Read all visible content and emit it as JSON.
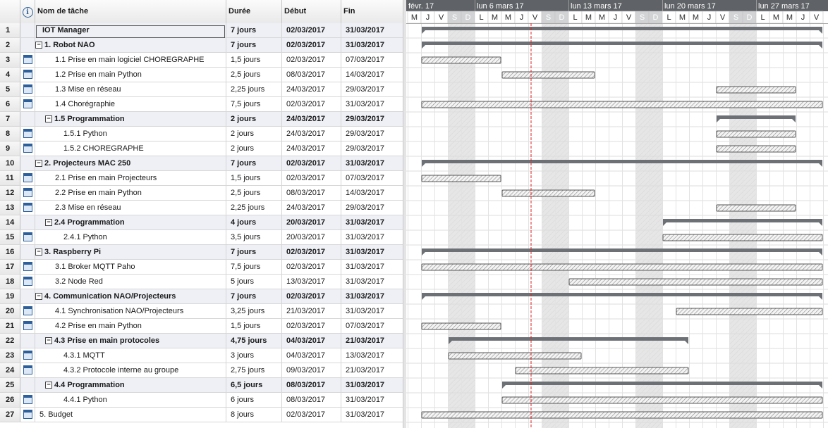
{
  "columns": {
    "id": "",
    "info_icon": "info-icon",
    "name": "Nom de tâche",
    "duration": "Durée",
    "start": "Début",
    "end": "Fin"
  },
  "tasks": [
    {
      "id": "1",
      "name": "IOT Manager",
      "duration": "7 jours",
      "start": "02/03/2017",
      "end": "31/03/2017",
      "level": 0,
      "summary": true,
      "icon": false,
      "toggle": false
    },
    {
      "id": "2",
      "name": "1. Robot NAO",
      "duration": "7 jours",
      "start": "02/03/2017",
      "end": "31/03/2017",
      "level": 0,
      "summary": true,
      "icon": false,
      "toggle": true
    },
    {
      "id": "3",
      "name": "1.1 Prise en main logiciel CHOREGRAPHE",
      "duration": "1,5 jours",
      "start": "02/03/2017",
      "end": "07/03/2017",
      "level": 1,
      "summary": false,
      "icon": true,
      "toggle": false
    },
    {
      "id": "4",
      "name": "1.2 Prise en main Python",
      "duration": "2,5 jours",
      "start": "08/03/2017",
      "end": "14/03/2017",
      "level": 1,
      "summary": false,
      "icon": true,
      "toggle": false
    },
    {
      "id": "5",
      "name": "1.3 Mise en réseau",
      "duration": "2,25 jours",
      "start": "24/03/2017",
      "end": "29/03/2017",
      "level": 1,
      "summary": false,
      "icon": true,
      "toggle": false
    },
    {
      "id": "6",
      "name": "1.4 Chorégraphie",
      "duration": "7,5 jours",
      "start": "02/03/2017",
      "end": "31/03/2017",
      "level": 1,
      "summary": false,
      "icon": true,
      "toggle": false
    },
    {
      "id": "7",
      "name": "1.5 Programmation",
      "duration": "2 jours",
      "start": "24/03/2017",
      "end": "29/03/2017",
      "level": 1,
      "summary": true,
      "icon": false,
      "toggle": true
    },
    {
      "id": "8",
      "name": "1.5.1 Python",
      "duration": "2 jours",
      "start": "24/03/2017",
      "end": "29/03/2017",
      "level": 2,
      "summary": false,
      "icon": true,
      "toggle": false
    },
    {
      "id": "9",
      "name": "1.5.2 CHOREGRAPHE",
      "duration": "2 jours",
      "start": "24/03/2017",
      "end": "29/03/2017",
      "level": 2,
      "summary": false,
      "icon": true,
      "toggle": false
    },
    {
      "id": "10",
      "name": "2. Projecteurs MAC 250",
      "duration": "7 jours",
      "start": "02/03/2017",
      "end": "31/03/2017",
      "level": 0,
      "summary": true,
      "icon": false,
      "toggle": true
    },
    {
      "id": "11",
      "name": "2.1 Prise en main Projecteurs",
      "duration": "1,5 jours",
      "start": "02/03/2017",
      "end": "07/03/2017",
      "level": 1,
      "summary": false,
      "icon": true,
      "toggle": false
    },
    {
      "id": "12",
      "name": "2.2 Prise en main Python",
      "duration": "2,5 jours",
      "start": "08/03/2017",
      "end": "14/03/2017",
      "level": 1,
      "summary": false,
      "icon": true,
      "toggle": false
    },
    {
      "id": "13",
      "name": "2.3 Mise en réseau",
      "duration": "2,25 jours",
      "start": "24/03/2017",
      "end": "29/03/2017",
      "level": 1,
      "summary": false,
      "icon": true,
      "toggle": false
    },
    {
      "id": "14",
      "name": "2.4 Programmation",
      "duration": "4 jours",
      "start": "20/03/2017",
      "end": "31/03/2017",
      "level": 1,
      "summary": true,
      "icon": false,
      "toggle": true
    },
    {
      "id": "15",
      "name": "2.4.1 Python",
      "duration": "3,5 jours",
      "start": "20/03/2017",
      "end": "31/03/2017",
      "level": 2,
      "summary": false,
      "icon": true,
      "toggle": false
    },
    {
      "id": "16",
      "name": "3. Raspberry Pi",
      "duration": "7 jours",
      "start": "02/03/2017",
      "end": "31/03/2017",
      "level": 0,
      "summary": true,
      "icon": false,
      "toggle": true
    },
    {
      "id": "17",
      "name": "3.1 Broker MQTT Paho",
      "duration": "7,5 jours",
      "start": "02/03/2017",
      "end": "31/03/2017",
      "level": 1,
      "summary": false,
      "icon": true,
      "toggle": false
    },
    {
      "id": "18",
      "name": "3.2 Node Red",
      "duration": "5 jours",
      "start": "13/03/2017",
      "end": "31/03/2017",
      "level": 1,
      "summary": false,
      "icon": true,
      "toggle": false
    },
    {
      "id": "19",
      "name": "4. Communication NAO/Projecteurs",
      "duration": "7 jours",
      "start": "02/03/2017",
      "end": "31/03/2017",
      "level": 0,
      "summary": true,
      "icon": false,
      "toggle": true
    },
    {
      "id": "20",
      "name": "4.1 Synchronisation NAO/Projecteurs",
      "duration": "3,25 jours",
      "start": "21/03/2017",
      "end": "31/03/2017",
      "level": 1,
      "summary": false,
      "icon": true,
      "toggle": false
    },
    {
      "id": "21",
      "name": "4.2 Prise en main Python",
      "duration": "1,5 jours",
      "start": "02/03/2017",
      "end": "07/03/2017",
      "level": 1,
      "summary": false,
      "icon": true,
      "toggle": false
    },
    {
      "id": "22",
      "name": "4.3 Prise en main protocoles",
      "duration": "4,75 jours",
      "start": "04/03/2017",
      "end": "21/03/2017",
      "level": 1,
      "summary": true,
      "icon": false,
      "toggle": true
    },
    {
      "id": "23",
      "name": "4.3.1 MQTT",
      "duration": "3 jours",
      "start": "04/03/2017",
      "end": "13/03/2017",
      "level": 2,
      "summary": false,
      "icon": true,
      "toggle": false
    },
    {
      "id": "24",
      "name": "4.3.2 Protocole interne au groupe",
      "duration": "2,75 jours",
      "start": "09/03/2017",
      "end": "21/03/2017",
      "level": 2,
      "summary": false,
      "icon": true,
      "toggle": false
    },
    {
      "id": "25",
      "name": "4.4 Programmation",
      "duration": "6,5 jours",
      "start": "08/03/2017",
      "end": "31/03/2017",
      "level": 1,
      "summary": true,
      "icon": false,
      "toggle": true
    },
    {
      "id": "26",
      "name": "4.4.1 Python",
      "duration": "6 jours",
      "start": "08/03/2017",
      "end": "31/03/2017",
      "level": 2,
      "summary": false,
      "icon": true,
      "toggle": false
    },
    {
      "id": "27",
      "name": "5. Budget",
      "duration": "8 jours",
      "start": "02/03/2017",
      "end": "31/03/2017",
      "level": 0,
      "summary": false,
      "icon": true,
      "toggle": false
    }
  ],
  "timeline": {
    "weeks": [
      "févr. 17",
      "lun 6 mars 17",
      "lun 13 mars 17",
      "lun 20 mars 17",
      "lun 27 mars 17"
    ],
    "days": [
      "M",
      "J",
      "V",
      "S",
      "D",
      "L",
      "M",
      "M",
      "J",
      "V",
      "S",
      "D",
      "L",
      "M",
      "M",
      "J",
      "V",
      "S",
      "D",
      "L",
      "M",
      "M",
      "J",
      "V",
      "S",
      "D",
      "L",
      "M",
      "M",
      "J",
      "V"
    ],
    "today_day_index": 9
  },
  "colors": {
    "summary_bar": "#6d7176",
    "task_bar_border": "#555555",
    "weekend_shade": "#e6e6e6",
    "today_line": "#e02020",
    "header_dark": "#5f6266",
    "header_light": "#d2d3d5",
    "summary_row_bg": "#eef0f6"
  }
}
